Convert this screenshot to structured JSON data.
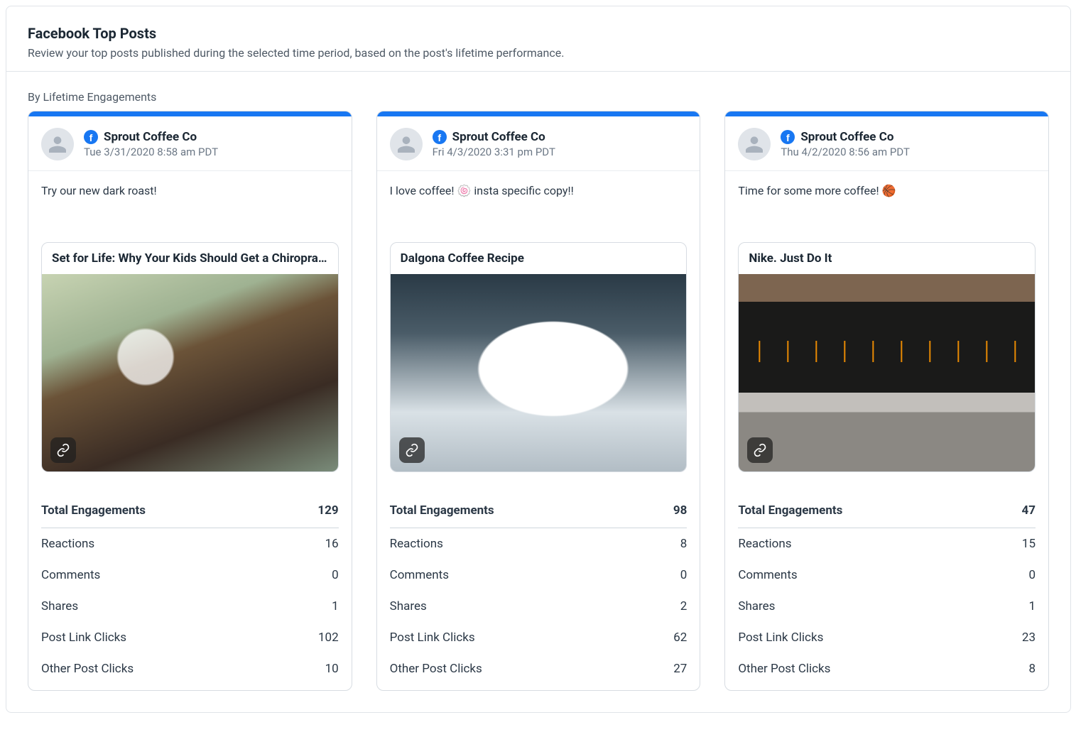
{
  "header": {
    "title": "Facebook Top Posts",
    "subtitle": "Review your top posts published during the selected time period, based on the post's lifetime performance."
  },
  "sort_label": "By Lifetime Engagements",
  "brand_color": "#1877f2",
  "metric_labels": {
    "total": "Total Engagements",
    "reactions": "Reactions",
    "comments": "Comments",
    "shares": "Shares",
    "post_link_clicks": "Post Link Clicks",
    "other_post_clicks": "Other Post Clicks"
  },
  "posts": [
    {
      "account": "Sprout Coffee Co",
      "timestamp": "Tue 3/31/2020 8:58 am PDT",
      "text": "Try our new dark roast!",
      "link_title": "Set for Life: Why Your Kids Should Get a Chiropract...",
      "metrics": {
        "total": "129",
        "reactions": "16",
        "comments": "0",
        "shares": "1",
        "post_link_clicks": "102",
        "other_post_clicks": "10"
      }
    },
    {
      "account": "Sprout Coffee Co",
      "timestamp": "Fri 4/3/2020 3:31 pm PDT",
      "text": "I love coffee! 🍥 insta specific copy!!",
      "link_title": "Dalgona Coffee Recipe",
      "metrics": {
        "total": "98",
        "reactions": "8",
        "comments": "0",
        "shares": "2",
        "post_link_clicks": "62",
        "other_post_clicks": "27"
      }
    },
    {
      "account": "Sprout Coffee Co",
      "timestamp": "Thu 4/2/2020 8:56 am PDT",
      "text": "Time for some more coffee! 🏀",
      "link_title": "Nike. Just Do It",
      "metrics": {
        "total": "47",
        "reactions": "15",
        "comments": "0",
        "shares": "1",
        "post_link_clicks": "23",
        "other_post_clicks": "8"
      }
    }
  ]
}
